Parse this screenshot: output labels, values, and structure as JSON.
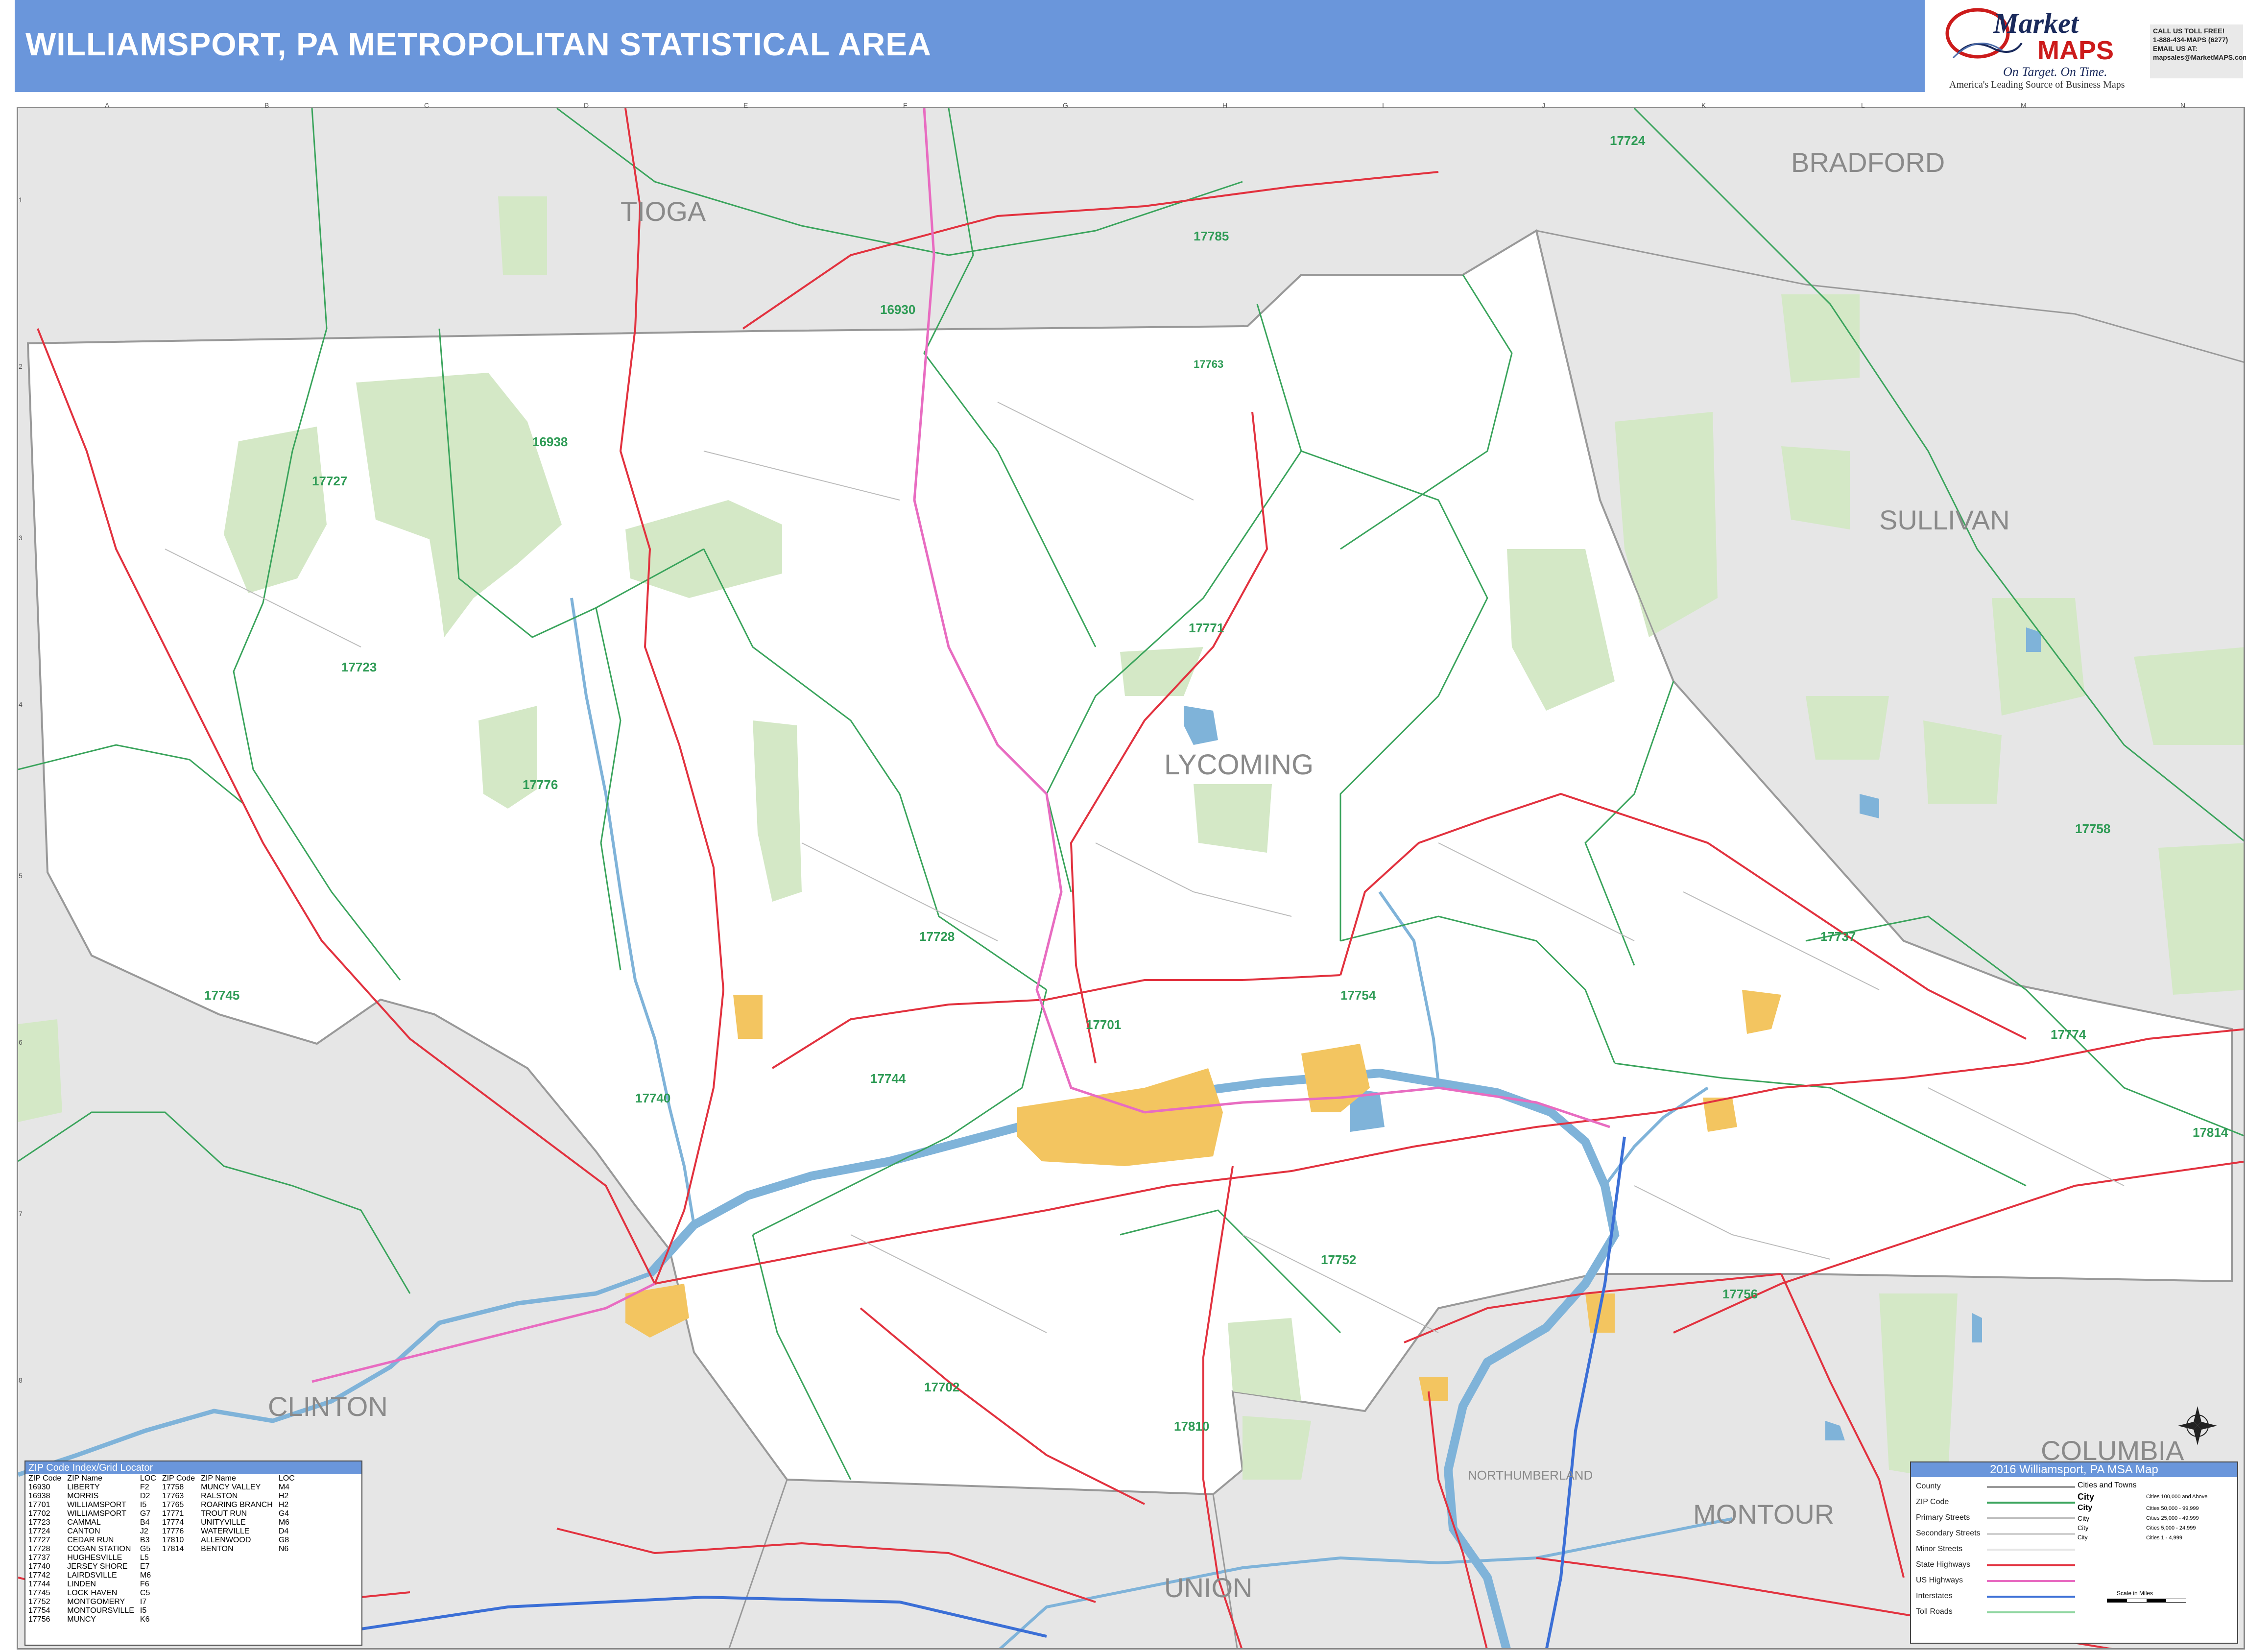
{
  "title": "WILLIAMSPORT, PA METROPOLITAN STATISTICAL AREA",
  "brand": {
    "name_part1": "Market",
    "name_part2": "MAPS",
    "tagline": "On Target. On Time.",
    "subtitle": "America's Leading Source of Business Maps",
    "contact_lines": [
      "CALL US TOLL FREE!",
      "1-888-434-MAPS (6277)",
      "EMAIL US AT:",
      "mapsales@MarketMAPS.com"
    ]
  },
  "grid": {
    "columns": [
      "A",
      "B",
      "C",
      "D",
      "E",
      "F",
      "G",
      "H",
      "I",
      "J",
      "K",
      "L",
      "M",
      "N"
    ],
    "rows": [
      "1",
      "2",
      "3",
      "4",
      "5",
      "6",
      "7",
      "8",
      "9"
    ]
  },
  "counties": [
    "TIOGA",
    "BRADFORD",
    "SULLIVAN",
    "LYCOMING",
    "CLINTON",
    "UNION",
    "MONTOUR",
    "COLUMBIA",
    "NORTHUMBERLAND"
  ],
  "zip_labels": [
    "17724",
    "17785",
    "16930",
    "16938",
    "17727",
    "17723",
    "17776",
    "17771",
    "17701",
    "17737",
    "17754",
    "17758",
    "17745",
    "17740",
    "17744",
    "17728",
    "17774",
    "17814",
    "17752",
    "17756",
    "17702",
    "17810",
    "17763"
  ],
  "index": {
    "header": "ZIP Code Index/Grid Locator",
    "columns": [
      "ZIP Code",
      "ZIP Name",
      "LOC",
      "ZIP Code",
      "ZIP Name",
      "LOC"
    ],
    "left": [
      [
        "16930",
        "LIBERTY",
        "F2"
      ],
      [
        "16938",
        "MORRIS",
        "D2"
      ],
      [
        "17701",
        "WILLIAMSPORT",
        "I5"
      ],
      [
        "17702",
        "WILLIAMSPORT",
        "G7"
      ],
      [
        "17723",
        "CAMMAL",
        "B4"
      ],
      [
        "17724",
        "CANTON",
        "J2"
      ],
      [
        "17727",
        "CEDAR RUN",
        "B3"
      ],
      [
        "17728",
        "COGAN STATION",
        "G5"
      ],
      [
        "17737",
        "HUGHESVILLE",
        "L5"
      ],
      [
        "17740",
        "JERSEY SHORE",
        "E7"
      ],
      [
        "17742",
        "LAIRDSVILLE",
        "M6"
      ],
      [
        "17744",
        "LINDEN",
        "F6"
      ],
      [
        "17745",
        "LOCK HAVEN",
        "C5"
      ],
      [
        "17752",
        "MONTGOMERY",
        "I7"
      ],
      [
        "17754",
        "MONTOURSVILLE",
        "I5"
      ],
      [
        "17756",
        "MUNCY",
        "K6"
      ]
    ],
    "right": [
      [
        "17758",
        "MUNCY VALLEY",
        "M4"
      ],
      [
        "17763",
        "RALSTON",
        "H2"
      ],
      [
        "17765",
        "ROARING BRANCH",
        "H2"
      ],
      [
        "17771",
        "TROUT RUN",
        "G4"
      ],
      [
        "17774",
        "UNITYVILLE",
        "M6"
      ],
      [
        "17776",
        "WATERVILLE",
        "D4"
      ],
      [
        "17810",
        "ALLENWOOD",
        "G8"
      ],
      [
        "17814",
        "BENTON",
        "N6"
      ]
    ]
  },
  "legend": {
    "header": "2016 Williamsport, PA MSA Map",
    "items": [
      "County",
      "ZIP Code",
      "Primary Streets",
      "Secondary Streets",
      "Minor Streets",
      "State Highways",
      "US Highways",
      "Interstates",
      "Toll Roads"
    ],
    "cities_title": "Cities and Towns",
    "cities": [
      [
        "City",
        "Cities 100,000 and Above"
      ],
      [
        "City",
        "Cities 50,000 - 99,999"
      ],
      [
        "City",
        "Cities 25,000 - 49,999"
      ],
      [
        "City",
        "Cities 5,000 - 24,999"
      ],
      [
        "City",
        "Cities 1 - 4,999"
      ]
    ],
    "scale_label": "Scale in Miles"
  },
  "colors": {
    "header_bg": "#6a96db",
    "county_fill": "#ffffff",
    "outside_fill": "#e6e6e6",
    "forest": "#d4e8c6",
    "zip_line": "#3aa45c",
    "state_hwy": "#e2323f",
    "us_hwy": "#e86cc1",
    "water": "#7fb3d9",
    "urban": "#f3c560"
  }
}
